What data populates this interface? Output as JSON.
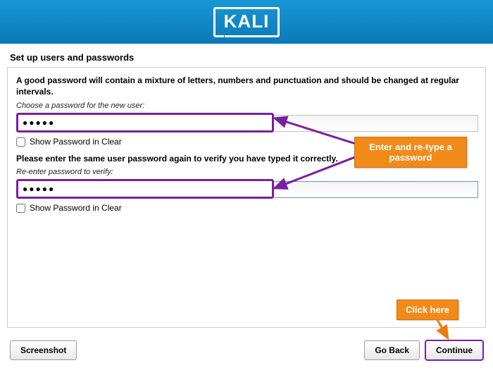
{
  "brand": "KALI",
  "title": "Set up users and passwords",
  "intro": "A good password will contain a mixture of letters, numbers and punctuation and should be changed at regular intervals.",
  "choose_caption": "Choose a password for the new user:",
  "password1": "●●●●●",
  "show1_label": "Show Password in Clear",
  "verify_text": "Please enter the same user password again to verify you have typed it correctly.",
  "reenter_caption": "Re-enter password to verify:",
  "password2": "●●●●●",
  "show2_label": "Show Password in Clear",
  "callout_main_l1": "Enter and re-type a",
  "callout_main_l2": "password",
  "callout_small": "Click here",
  "btn_screenshot": "Screenshot",
  "btn_goback": "Go Back",
  "btn_continue": "Continue"
}
